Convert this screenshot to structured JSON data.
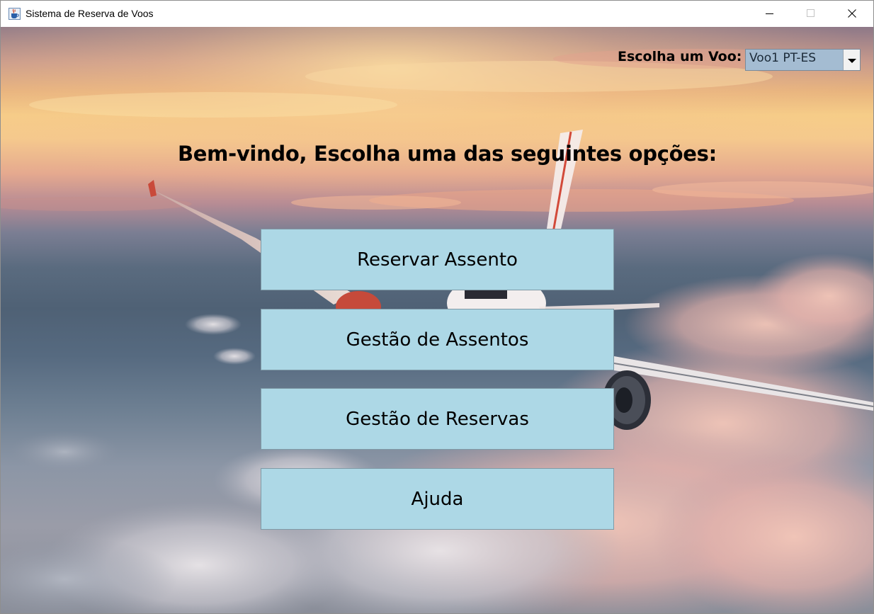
{
  "window": {
    "title": "Sistema de Reserva de Voos",
    "icons": {
      "app": "java-cup-icon",
      "minimize": "minimize-icon",
      "maximize": "maximize-icon",
      "close": "close-icon"
    }
  },
  "flight_selector": {
    "label": "Escolha um Voo:",
    "selected": "Voo1 PT-ES",
    "icon": "dropdown-arrow-icon",
    "color": "#a4bcd2"
  },
  "welcome_text": "Bem-vindo, Escolha uma das seguintes opções:",
  "menu": {
    "button_color": "#add8e6",
    "buttons": [
      {
        "label": "Reservar Assento"
      },
      {
        "label": "Gestão de Assentos"
      },
      {
        "label": "Gestão de Reservas"
      },
      {
        "label": "Ajuda"
      }
    ]
  },
  "background": {
    "description_icon": "airplane-sky-background"
  }
}
